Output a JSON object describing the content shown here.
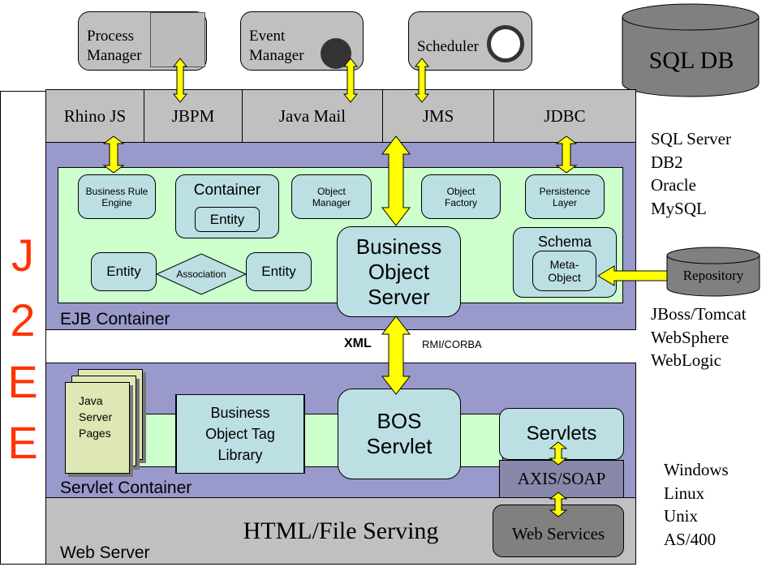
{
  "side_label": [
    "J",
    "2",
    "E",
    "E"
  ],
  "top_services": {
    "process_manager": "Process Manager",
    "event_manager": "Event Manager",
    "scheduler": "Scheduler"
  },
  "database": "SQL DB",
  "integration_bar": [
    "Rhino JS",
    "JBPM",
    "Java Mail",
    "JMS",
    "JDBC"
  ],
  "ejb": {
    "label": "EJB Container",
    "business_rule_engine": "Business Rule Engine",
    "container": "Container",
    "container_entity": "Entity",
    "object_manager": "Object Manager",
    "object_factory": "Object Factory",
    "persistence_layer": "Persistence Layer",
    "entity_left": "Entity",
    "association": "Association",
    "entity_right": "Entity",
    "bos": "Business Object Server",
    "schema": "Schema",
    "meta_object": "Meta-Object"
  },
  "protocols": {
    "xml": "XML",
    "rmi": "RMI/CORBA"
  },
  "servlet": {
    "label": "Servlet Container",
    "jsp": "Java Server Pages",
    "tag_library": "Business Object Tag Library",
    "bos_servlet": "BOS Servlet",
    "servlets": "Servlets",
    "axis": "AXIS/SOAP"
  },
  "web_server": {
    "label": "Web Server",
    "file_serving": "HTML/File Serving",
    "web_services": "Web Services"
  },
  "repository": "Repository",
  "databases": [
    "SQL Server",
    "DB2",
    "Oracle",
    "MySQL"
  ],
  "app_servers": [
    "JBoss/Tomcat",
    "WebSphere",
    "WebLogic"
  ],
  "operating_systems": [
    "Windows",
    "Linux",
    "Unix",
    "AS/400"
  ],
  "colors": {
    "arrow": "#ffff00",
    "ejb_bg": "#9999cc",
    "inner_bg": "#ccffcc",
    "box": "#bcdfe3",
    "gray": "#c0c0c0",
    "j2ee": "#ff3300"
  }
}
